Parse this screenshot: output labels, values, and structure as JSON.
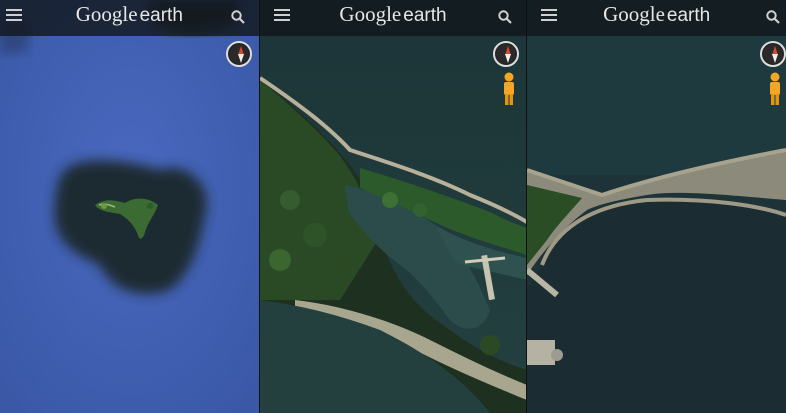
{
  "panels": [
    {
      "brand_google": "Google",
      "brand_earth": "earth",
      "menu_icon": "hamburger-menu-icon",
      "search_icon": "search-icon",
      "compass_icon": "compass-icon"
    },
    {
      "brand_google": "Google",
      "brand_earth": "earth",
      "menu_icon": "hamburger-menu-icon",
      "search_icon": "search-icon",
      "compass_icon": "compass-icon",
      "pegman_icon": "pegman-icon"
    },
    {
      "brand_google": "Google",
      "brand_earth": "earth",
      "menu_icon": "hamburger-menu-icon",
      "search_icon": "search-icon",
      "compass_icon": "compass-icon",
      "pegman_icon": "pegman-icon"
    }
  ],
  "colors": {
    "ocean_blue": "#3f5fb0",
    "sea_dark": "#1f3a3d",
    "pegman_orange": "#f5a623",
    "compass_red": "#d64a2e"
  }
}
